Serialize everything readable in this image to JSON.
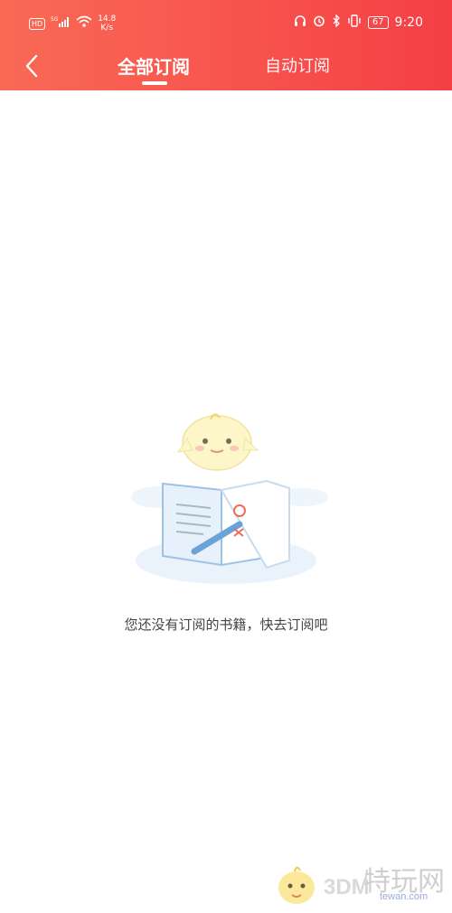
{
  "status_bar": {
    "hd": "HD",
    "network": "5G",
    "speed_value": "14.8",
    "speed_unit": "K/s",
    "battery": "67",
    "time": "9:20"
  },
  "header": {
    "tabs": [
      {
        "label": "全部订阅",
        "active": true
      },
      {
        "label": "自动订阅",
        "active": false
      }
    ]
  },
  "empty_state": {
    "message": "您还没有订阅的书籍，快去订阅吧"
  },
  "watermark": {
    "logo_text": "3DM",
    "brand": "特玩网",
    "url": "tewan.com"
  },
  "colors": {
    "header_start": "#f96a55",
    "header_end": "#f43f45",
    "text": "#444444"
  }
}
